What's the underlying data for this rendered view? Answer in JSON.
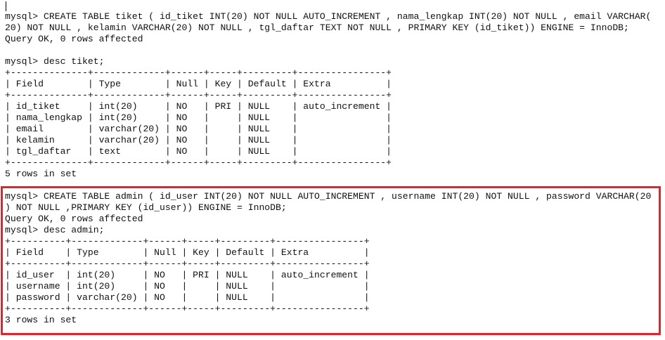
{
  "terminal": {
    "highlight_color": "#e8202a",
    "lines": [
      "mysql> CREATE TABLE tiket ( id_tiket INT(20) NOT NULL AUTO_INCREMENT , nama_lengkap INT(20) NOT NULL , email VARCHAR(",
      "20) NOT NULL , kelamin VARCHAR(20) NOT NULL , tgl_daftar TEXT NOT NULL , PRIMARY KEY (id_tiket)) ENGINE = InnoDB;",
      "Query OK, 0 rows affected",
      "",
      "mysql> desc tiket;",
      "+--------------+-------------+------+-----+---------+----------------+",
      "| Field        | Type        | Null | Key | Default | Extra          |",
      "+--------------+-------------+------+-----+---------+----------------+",
      "| id_tiket     | int(20)     | NO   | PRI | NULL    | auto_increment |",
      "| nama_lengkap | int(20)     | NO   |     | NULL    |                |",
      "| email        | varchar(20) | NO   |     | NULL    |                |",
      "| kelamin      | varchar(20) | NO   |     | NULL    |                |",
      "| tgl_daftar   | text        | NO   |     | NULL    |                |",
      "+--------------+-------------+------+-----+---------+----------------+",
      "5 rows in set",
      "",
      "mysql> CREATE TABLE admin ( id_user INT(20) NOT NULL AUTO_INCREMENT , username INT(20) NOT NULL , password VARCHAR(20",
      ") NOT NULL ,PRIMARY KEY (id_user)) ENGINE = InnoDB;",
      "Query OK, 0 rows affected",
      "mysql> desc admin;",
      "+----------+-------------+------+-----+---------+----------------+",
      "| Field    | Type        | Null | Key | Default | Extra          |",
      "+----------+-------------+------+-----+---------+----------------+",
      "| id_user  | int(20)     | NO   | PRI | NULL    | auto_increment |",
      "| username | int(20)     | NO   |     | NULL    |                |",
      "| password | varchar(20) | NO   |     | NULL    |                |",
      "+----------+-------------+------+-----+---------+----------------+",
      "3 rows in set"
    ]
  }
}
